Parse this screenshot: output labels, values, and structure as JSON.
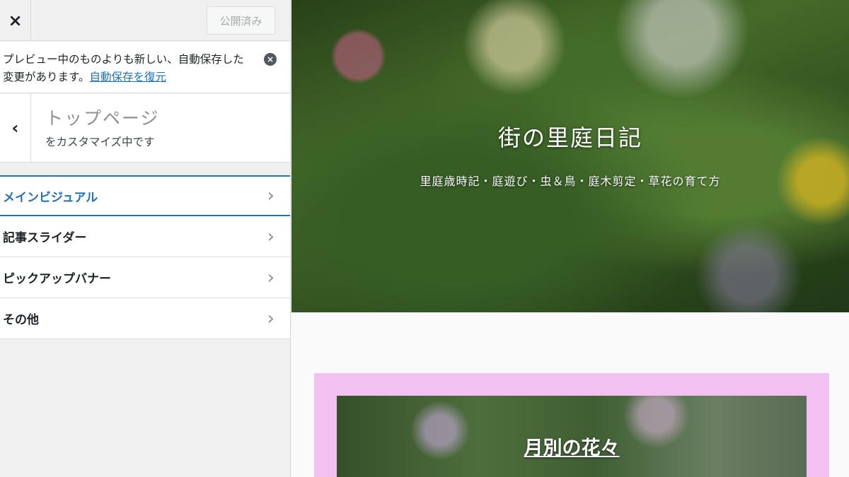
{
  "topbar": {
    "close_icon": "×",
    "publish_label": "公開済み"
  },
  "notice": {
    "message": "プレビュー中のものよりも新しい、自動保存した変更があります。",
    "link": "自動保存を復元",
    "dismiss_icon": "×"
  },
  "section": {
    "back_icon": "‹",
    "title": "トップページ",
    "subtitle": "をカスタマイズ中です"
  },
  "menu": {
    "items": [
      {
        "label": "メインビジュアル"
      },
      {
        "label": "記事スライダー"
      },
      {
        "label": "ピックアップバナー"
      },
      {
        "label": "その他"
      }
    ],
    "chevron_icon": "›"
  },
  "preview": {
    "site_title": "街の里庭日記",
    "tagline": "里庭歳時記・庭遊び・虫＆鳥・庭木剪定・草花の育て方",
    "banner_title": "月別の花々"
  },
  "colors": {
    "accent": "#2271b1",
    "banner_frame": "#f2c1f2"
  }
}
